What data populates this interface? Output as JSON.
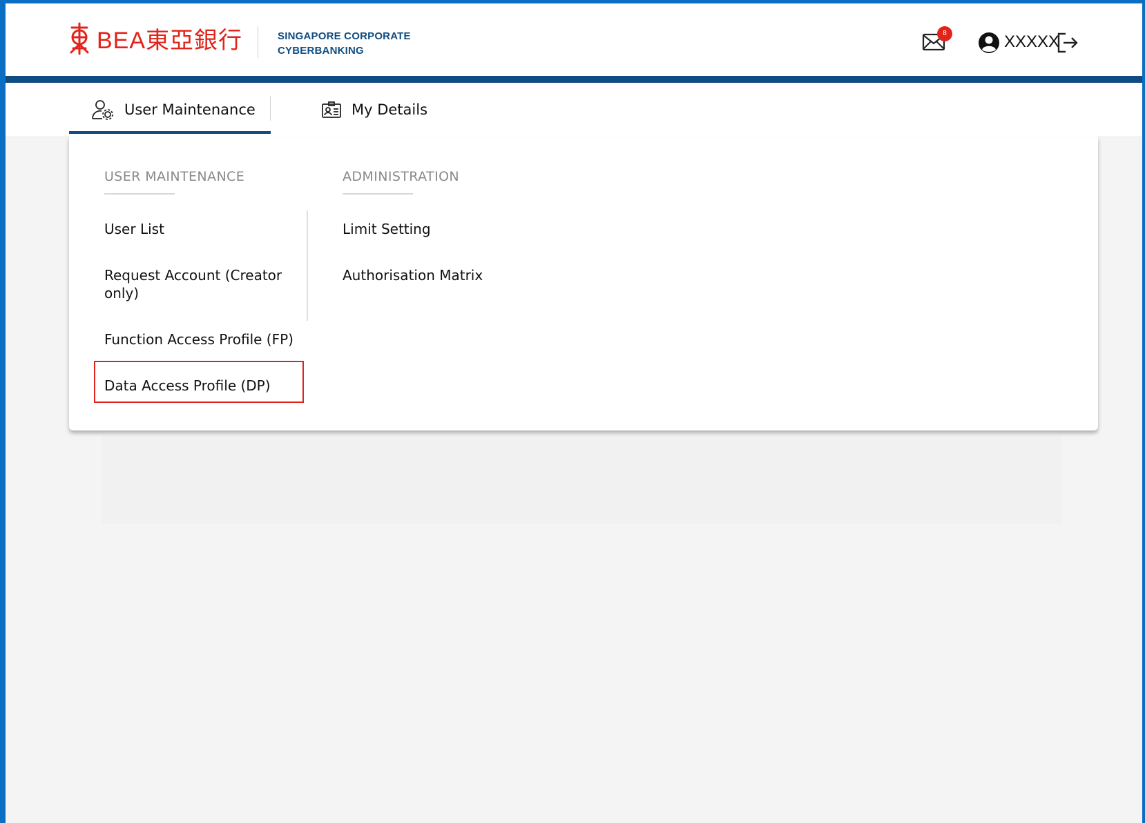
{
  "brand": {
    "logo_text": "BEA東亞銀行",
    "title_line1": "SINGAPORE CORPORATE",
    "title_line2": "CYBERBANKING",
    "primary_color": "#0f4c81",
    "brand_red": "#e2231a"
  },
  "header": {
    "mail_icon": "envelope-icon",
    "mail_badge": "8",
    "user_icon": "user-circle-icon",
    "username": "XXXXX",
    "logout_icon": "logout-icon"
  },
  "tabs": [
    {
      "label": "User Maintenance",
      "icon": "user-gear-icon",
      "active": true
    },
    {
      "label": "My Details",
      "icon": "id-card-icon",
      "active": false
    }
  ],
  "menu": {
    "columns": [
      {
        "heading": "USER MAINTENANCE",
        "items": [
          "User List",
          "Request Account (Creator only)",
          "Function Access Profile (FP)",
          "Data Access Profile (DP)"
        ]
      },
      {
        "heading": "ADMINISTRATION",
        "items": [
          "Limit Setting",
          "Authorisation Matrix"
        ]
      }
    ],
    "highlighted_item": "Data Access Profile (DP)"
  }
}
